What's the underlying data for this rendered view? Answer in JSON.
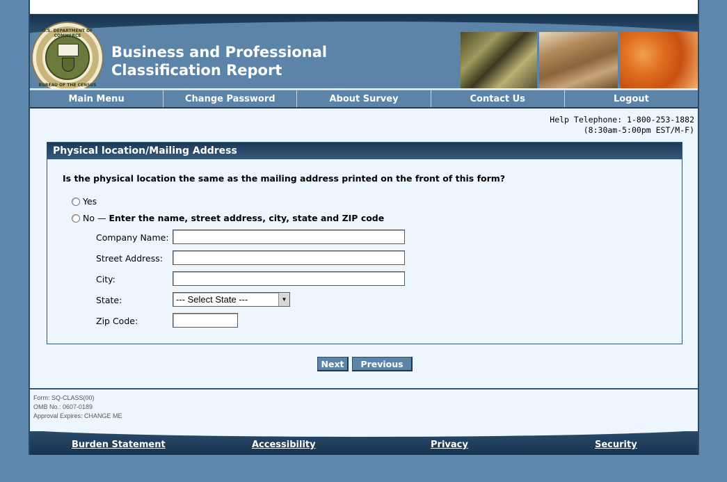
{
  "header": {
    "title_line1": "Business and Professional",
    "title_line2": "Classification Report",
    "seal_top_text": "U.S. DEPARTMENT OF COMMERCE",
    "seal_bottom_text": "BUREAU OF THE CENSUS"
  },
  "nav": {
    "items": [
      {
        "label": "Main Menu"
      },
      {
        "label": "Change Password"
      },
      {
        "label": "About Survey"
      },
      {
        "label": "Contact Us"
      },
      {
        "label": "Logout"
      }
    ]
  },
  "help": {
    "telephone": "Help Telephone: 1-800-253-1882",
    "hours": "(8:30am-5:00pm EST/M-F)"
  },
  "panel": {
    "title": "Physical location/Mailing Address",
    "question": "Is the physical location the same as the mailing address printed on the front of this form?",
    "yes_label": "Yes",
    "no_label": "No —",
    "no_instruction": "Enter the name, street address, city, state and ZIP code"
  },
  "form": {
    "company_label": "Company Name:",
    "company_value": "",
    "street_label": "Street Address:",
    "street_value": "",
    "city_label": "City:",
    "city_value": "",
    "state_label": "State:",
    "state_selected": "--- Select State ---",
    "zip_label": "Zip Code:",
    "zip_value": ""
  },
  "buttons": {
    "next": "Next",
    "previous": "Previous"
  },
  "footer_info": {
    "form": "Form: SQ-CLASS(00)",
    "omb": "OMB No.: 0607-0189",
    "approval": "Approval Expires: CHANGE ME"
  },
  "footer_links": {
    "burden": "Burden Statement",
    "accessibility": "Accessibility",
    "privacy": "Privacy",
    "security": "Security"
  }
}
